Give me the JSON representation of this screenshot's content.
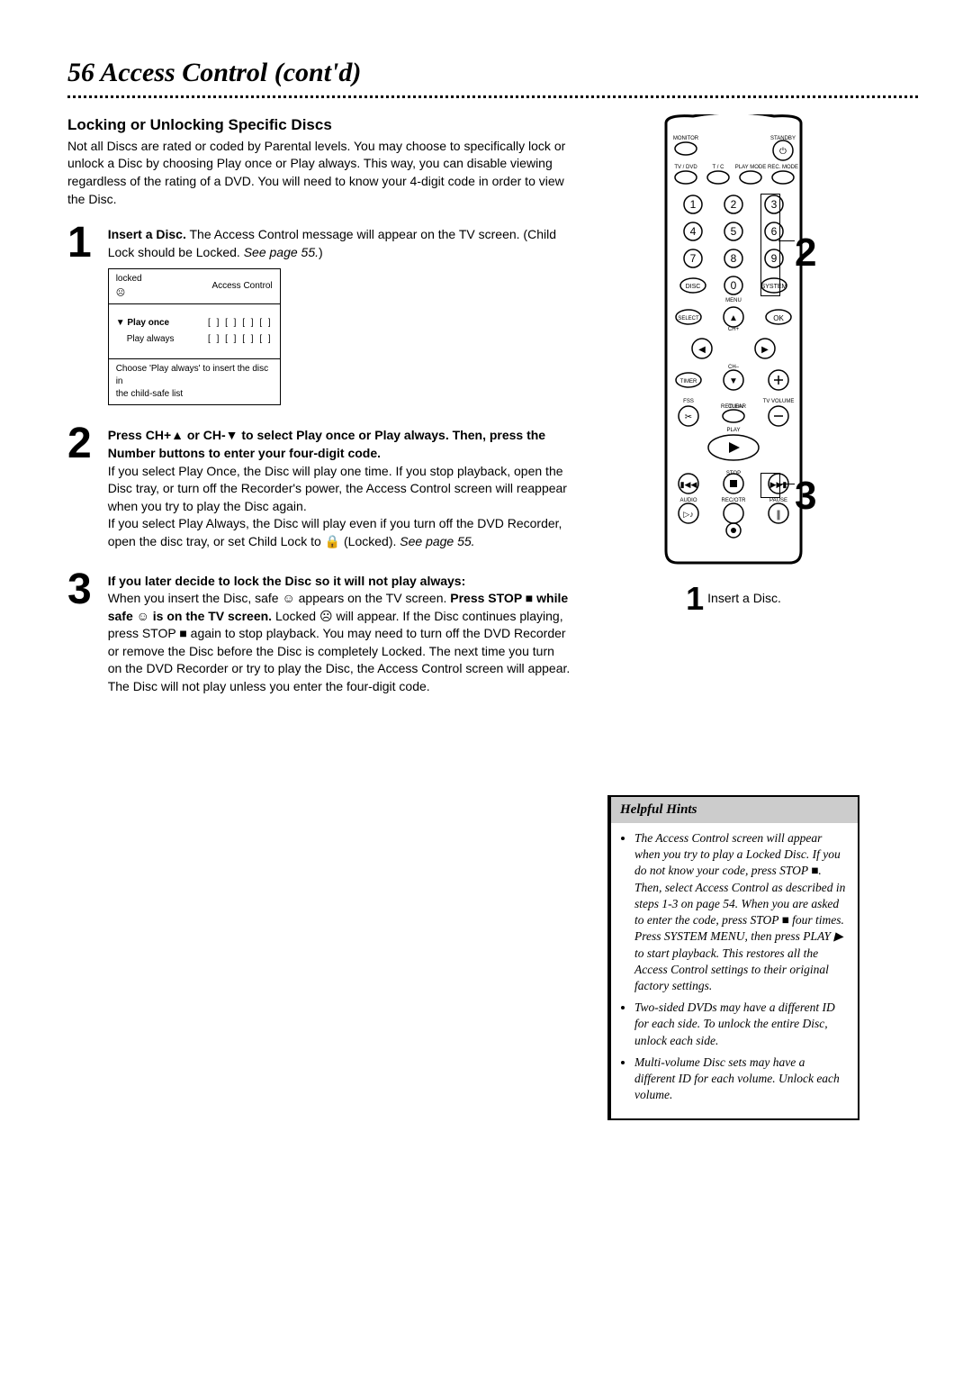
{
  "page": {
    "number": "56",
    "title": "Access Control (cont'd)"
  },
  "subtitle": "Locking or Unlocking Specific Discs",
  "intro": "Not all Discs are rated or coded by Parental levels. You may choose to specifically lock or unlock a Disc by choosing Play once or Play always. This way, you can disable viewing regardless of the rating of a DVD.  You will need to know your 4-digit code in order to view the Disc.",
  "step1": {
    "num": "1",
    "bold": "Insert a Disc.",
    "text": " The Access Control message will appear on the TV screen. (Child Lock should be Locked. ",
    "ital": "See page 55.",
    "close": ")"
  },
  "onscreen": {
    "locked": "locked",
    "header": "Access Control",
    "play_once": "Play once",
    "play_always": "Play always",
    "dots": "[ ] [ ] [ ] [ ]",
    "footer1": "Choose 'Play always' to insert the disc in",
    "footer2": "the child-safe list"
  },
  "step2": {
    "num": "2",
    "bold": "Press CH+▲ or CH-▼ to select Play once or Play always. Then, press the Number buttons to enter your four-digit code.",
    "para1": "If you select Play Once, the Disc will play one time. If you stop playback, open the Disc tray, or turn off the Recorder's power, the Access Control screen will reappear when you try to play the Disc again.",
    "para2_a": "If you select Play Always, the Disc will play even if you turn off the DVD Recorder, open the disc tray, or set Child Lock to ",
    "para2_b": " (Locked). ",
    "ital": "See page 55."
  },
  "step3": {
    "num": "3",
    "bold": "If you later decide to lock the Disc so it will not play always:",
    "line1": "When you insert the Disc, safe ☺ appears on the TV screen. ",
    "bold2": "Press STOP ■ while safe ☺ is on the TV screen.",
    "line2": " Locked ☹ will appear. If the Disc continues playing, press STOP ■ again to stop playback. You may need to turn off the DVD Recorder or remove the Disc before the Disc is completely Locked. The next time you turn on the DVD Recorder or try to play the Disc, the Access Control screen will appear. The Disc will not play unless you enter the four-digit code."
  },
  "remote": {
    "labels": {
      "monitor": "MONITOR",
      "standby": "STANDBY",
      "tvdvd": "TV / DVD",
      "tc": "T / C",
      "playmode": "PLAY MODE",
      "recmode": "REC. MODE",
      "disc": "DISC",
      "menu": "MENU",
      "system": "SYSTEM",
      "select": "SELECT",
      "ok": "OK",
      "chplus": "CH+",
      "chminus": "CH–",
      "timer": "TIMER",
      "tvvol": "TV VOLUME",
      "fss": "FSS",
      "return": "RETURN",
      "clear": "CLEAR",
      "play": "PLAY",
      "stop": "STOP",
      "audio": "AUDIO",
      "recotr": "REC/OTR",
      "pause": "PAUSE"
    },
    "caption_num": "1",
    "caption": "Insert a Disc.",
    "callout2": "2",
    "callout3": "3"
  },
  "hints": {
    "header": "Helpful Hints",
    "item1": "The Access Control screen will appear when you try to play a Locked Disc. If you do not know your code, press STOP ■. Then, select Access Control as described in steps 1-3 on page 54.  When you are asked to enter the code, press STOP ■ four times. Press SYSTEM MENU, then press PLAY ▶ to start playback. This restores all the Access Control settings to their original factory settings.",
    "item2": "Two-sided DVDs may have a different ID for each side. To unlock the entire Disc, unlock each side.",
    "item3": "Multi-volume Disc sets may have a different ID for each volume. Unlock each volume."
  }
}
